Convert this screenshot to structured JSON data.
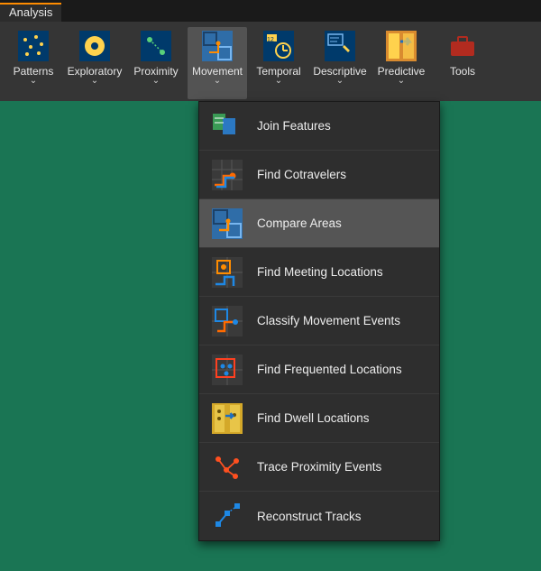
{
  "tab": {
    "label": "Analysis"
  },
  "ribbon": {
    "items": [
      {
        "label": "Patterns",
        "dropdown": true
      },
      {
        "label": "Exploratory",
        "dropdown": true
      },
      {
        "label": "Proximity",
        "dropdown": true
      },
      {
        "label": "Movement",
        "dropdown": true,
        "selected": true
      },
      {
        "label": "Temporal",
        "dropdown": true
      },
      {
        "label": "Descriptive",
        "dropdown": true
      },
      {
        "label": "Predictive",
        "dropdown": true
      },
      {
        "label": "Tools",
        "dropdown": false
      }
    ]
  },
  "dropdown": {
    "items": [
      {
        "label": "Join Features",
        "hover": false
      },
      {
        "label": "Find Cotravelers",
        "hover": false
      },
      {
        "label": "Compare Areas",
        "hover": true
      },
      {
        "label": "Find Meeting Locations",
        "hover": false
      },
      {
        "label": "Classify Movement Events",
        "hover": false
      },
      {
        "label": "Find Frequented Locations",
        "hover": false
      },
      {
        "label": "Find Dwell Locations",
        "hover": false
      },
      {
        "label": "Trace Proximity Events",
        "hover": false
      },
      {
        "label": "Reconstruct Tracks",
        "hover": false
      }
    ]
  },
  "colors": {
    "accent": "#ff8c00",
    "bg_ribbon": "#353535",
    "bg_menu": "#2e2e2e"
  }
}
